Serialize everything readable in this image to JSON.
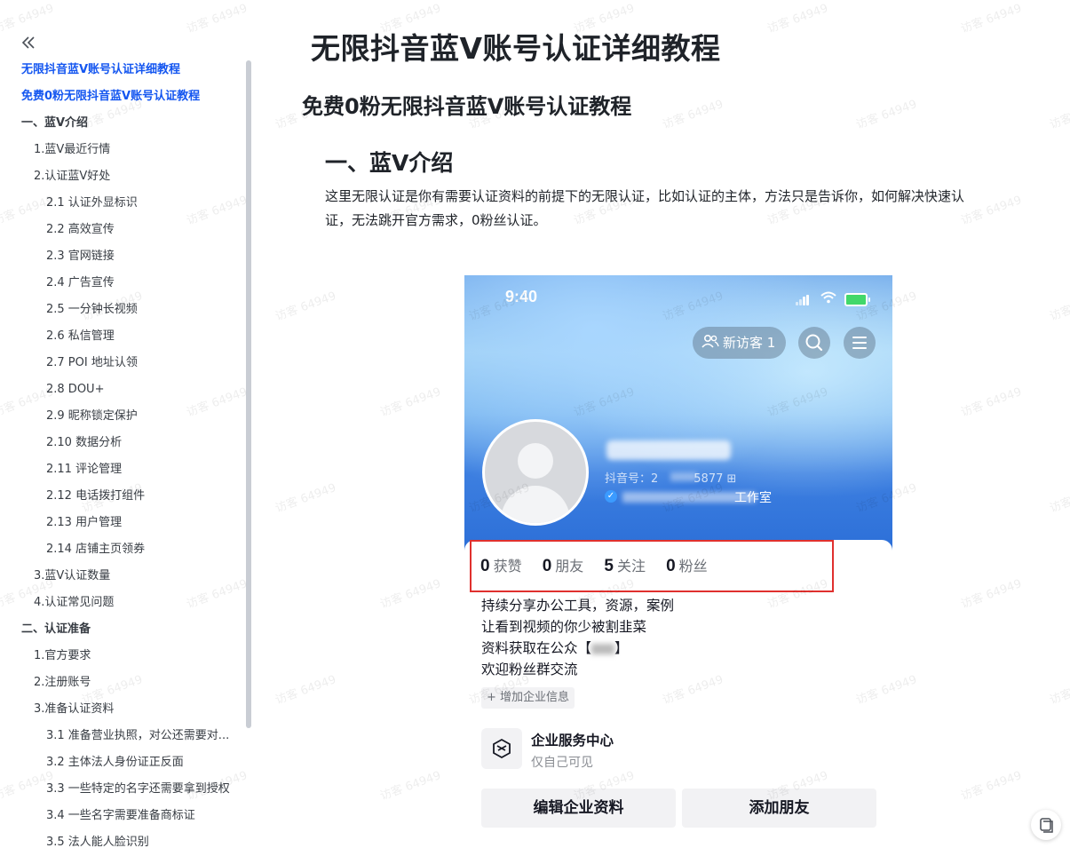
{
  "sidebar": {
    "collapse_icon": "double-chevron-left-icon",
    "toc": [
      {
        "label": "无限抖音蓝V账号认证详细教程",
        "level": 0,
        "active": true
      },
      {
        "label": "免费0粉无限抖音蓝V账号认证教程",
        "level": 0,
        "active": true
      },
      {
        "label": "一、蓝V介绍",
        "level": 0
      },
      {
        "label": "1.蓝V最近行情",
        "level": 1
      },
      {
        "label": "2.认证蓝V好处",
        "level": 1
      },
      {
        "label": "2.1 认证外显标识",
        "level": 2
      },
      {
        "label": "2.2 高效宣传",
        "level": 2
      },
      {
        "label": "2.3 官网链接",
        "level": 2
      },
      {
        "label": "2.4 广告宣传",
        "level": 2
      },
      {
        "label": "2.5 一分钟长视频",
        "level": 2
      },
      {
        "label": "2.6 私信管理",
        "level": 2
      },
      {
        "label": "2.7 POI 地址认领",
        "level": 2
      },
      {
        "label": "2.8 DOU+",
        "level": 2
      },
      {
        "label": "2.9 昵称锁定保护",
        "level": 2
      },
      {
        "label": "2.10 数据分析",
        "level": 2
      },
      {
        "label": "2.11 评论管理",
        "level": 2
      },
      {
        "label": "2.12 电话拨打组件",
        "level": 2
      },
      {
        "label": "2.13 用户管理",
        "level": 2
      },
      {
        "label": "2.14 店铺主页领券",
        "level": 2
      },
      {
        "label": "3.蓝V认证数量",
        "level": 1
      },
      {
        "label": "4.认证常见问题",
        "level": 1
      },
      {
        "label": "二、认证准备",
        "level": 0
      },
      {
        "label": "1.官方要求",
        "level": 1
      },
      {
        "label": "2.注册账号",
        "level": 1
      },
      {
        "label": "3.准备认证资料",
        "level": 1
      },
      {
        "label": "3.1 准备营业执照，对公还需要对...",
        "level": 2
      },
      {
        "label": "3.2 主体法人身份证正反面",
        "level": 2
      },
      {
        "label": "3.3 一些特定的名字还需要拿到授权",
        "level": 2
      },
      {
        "label": "3.4 一些名字需要准备商标证",
        "level": 2
      },
      {
        "label": "3.5 法人能人脸识别",
        "level": 2
      }
    ]
  },
  "main": {
    "title": "无限抖音蓝V账号认证详细教程",
    "subtitle": "免费0粉无限抖音蓝V账号认证教程",
    "section_heading": "一、蓝V介绍",
    "intro_line1": "这里无限认证是你有需要认证资料的前提下的无限认证，比如认证的主体，方法只是告诉你，如何解决快速认",
    "intro_line2": "证，无法跳开官方需求，0粉丝认证。"
  },
  "screenshot": {
    "status_time": "9:40",
    "visitor_label": "新访客 1",
    "visitor_icon": "users-icon",
    "search_icon": "search-icon",
    "menu_icon": "menu-icon",
    "douyin_id_prefix": "抖音号：2",
    "douyin_id_suffix": "5877 ⊞",
    "org_suffix": "工作室",
    "stats": [
      {
        "value": "0",
        "label": "获赞"
      },
      {
        "value": "0",
        "label": "朋友"
      },
      {
        "value": "5",
        "label": "关注"
      },
      {
        "value": "0",
        "label": "粉丝"
      }
    ],
    "bio": {
      "line1": "持续分享办公工具，资源，案例",
      "line2": "让看到视频的你少被割韭菜",
      "line3_prefix": "资料获取在公众【",
      "line3_suffix": "】",
      "line4": "欢迎粉丝群交流"
    },
    "add_enterprise_info": "+ 增加企业信息",
    "service_title": "企业服务中心",
    "service_sub": "仅自己可见",
    "button_edit": "编辑企业资料",
    "button_add_friend": "添加朋友",
    "highlight_color": "#e0302e"
  },
  "watermark_text": "访客 64949",
  "accent_color": "#1456f0"
}
